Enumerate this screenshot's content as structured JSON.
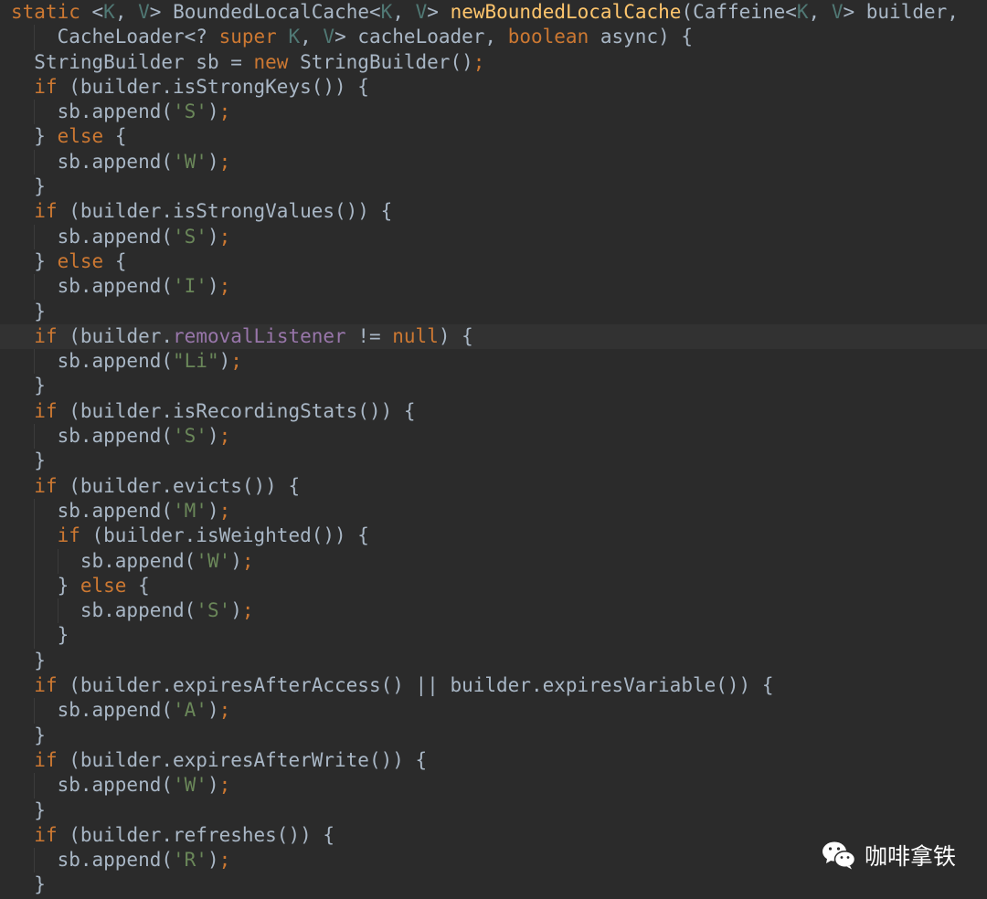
{
  "editor": {
    "lines": [
      {
        "indent": 0,
        "tokens": [
          {
            "t": "static ",
            "c": "kw"
          },
          {
            "t": "<",
            "c": "pl"
          },
          {
            "t": "K",
            "c": "tp"
          },
          {
            "t": ", ",
            "c": "pl"
          },
          {
            "t": "V",
            "c": "tp"
          },
          {
            "t": "> BoundedLocalCache<",
            "c": "pl"
          },
          {
            "t": "K",
            "c": "tp"
          },
          {
            "t": ", ",
            "c": "pl"
          },
          {
            "t": "V",
            "c": "tp"
          },
          {
            "t": "> ",
            "c": "pl"
          },
          {
            "t": "newBoundedLocalCache",
            "c": "fn"
          },
          {
            "t": "(Caffeine<",
            "c": "pl"
          },
          {
            "t": "K",
            "c": "tp"
          },
          {
            "t": ", ",
            "c": "pl"
          },
          {
            "t": "V",
            "c": "tp"
          },
          {
            "t": "> builder,",
            "c": "pl"
          }
        ]
      },
      {
        "indent": 2,
        "tokens": [
          {
            "t": "CacheLoader<? ",
            "c": "pl"
          },
          {
            "t": "super ",
            "c": "kw"
          },
          {
            "t": "K",
            "c": "tp"
          },
          {
            "t": ", ",
            "c": "pl"
          },
          {
            "t": "V",
            "c": "tp"
          },
          {
            "t": "> cacheLoader, ",
            "c": "pl"
          },
          {
            "t": "boolean ",
            "c": "kw"
          },
          {
            "t": "async) {",
            "c": "pl"
          }
        ]
      },
      {
        "indent": 1,
        "tokens": [
          {
            "t": "StringBuilder sb = ",
            "c": "pl"
          },
          {
            "t": "new ",
            "c": "kw"
          },
          {
            "t": "StringBuilder()",
            "c": "pl"
          },
          {
            "t": ";",
            "c": "kw"
          }
        ]
      },
      {
        "indent": 1,
        "tokens": [
          {
            "t": "if ",
            "c": "kw"
          },
          {
            "t": "(builder.isStrongKeys()) {",
            "c": "pl"
          }
        ]
      },
      {
        "indent": 2,
        "tokens": [
          {
            "t": "sb.append(",
            "c": "pl"
          },
          {
            "t": "'S'",
            "c": "str"
          },
          {
            "t": ")",
            "c": "pl"
          },
          {
            "t": ";",
            "c": "kw"
          }
        ]
      },
      {
        "indent": 1,
        "tokens": [
          {
            "t": "} ",
            "c": "pl"
          },
          {
            "t": "else ",
            "c": "kw"
          },
          {
            "t": "{",
            "c": "pl"
          }
        ]
      },
      {
        "indent": 2,
        "tokens": [
          {
            "t": "sb.append(",
            "c": "pl"
          },
          {
            "t": "'W'",
            "c": "str"
          },
          {
            "t": ")",
            "c": "pl"
          },
          {
            "t": ";",
            "c": "kw"
          }
        ]
      },
      {
        "indent": 1,
        "tokens": [
          {
            "t": "}",
            "c": "pl"
          }
        ]
      },
      {
        "indent": 1,
        "tokens": [
          {
            "t": "if ",
            "c": "kw"
          },
          {
            "t": "(builder.isStrongValues()) {",
            "c": "pl"
          }
        ]
      },
      {
        "indent": 2,
        "tokens": [
          {
            "t": "sb.append(",
            "c": "pl"
          },
          {
            "t": "'S'",
            "c": "str"
          },
          {
            "t": ")",
            "c": "pl"
          },
          {
            "t": ";",
            "c": "kw"
          }
        ]
      },
      {
        "indent": 1,
        "tokens": [
          {
            "t": "} ",
            "c": "pl"
          },
          {
            "t": "else ",
            "c": "kw"
          },
          {
            "t": "{",
            "c": "pl"
          }
        ]
      },
      {
        "indent": 2,
        "tokens": [
          {
            "t": "sb.append(",
            "c": "pl"
          },
          {
            "t": "'I'",
            "c": "str"
          },
          {
            "t": ")",
            "c": "pl"
          },
          {
            "t": ";",
            "c": "kw"
          }
        ]
      },
      {
        "indent": 1,
        "tokens": [
          {
            "t": "}",
            "c": "pl"
          }
        ]
      },
      {
        "indent": 1,
        "current": true,
        "tokens": [
          {
            "t": "if ",
            "c": "kw"
          },
          {
            "t": "(builder.",
            "c": "pl"
          },
          {
            "t": "removalListener",
            "c": "fld"
          },
          {
            "t": " != ",
            "c": "pl"
          },
          {
            "t": "null",
            "c": "kw"
          },
          {
            "t": ") {",
            "c": "pl"
          }
        ]
      },
      {
        "indent": 2,
        "tokens": [
          {
            "t": "sb.append(",
            "c": "pl"
          },
          {
            "t": "\"Li\"",
            "c": "str"
          },
          {
            "t": ")",
            "c": "pl"
          },
          {
            "t": ";",
            "c": "kw"
          }
        ]
      },
      {
        "indent": 1,
        "tokens": [
          {
            "t": "}",
            "c": "pl"
          }
        ]
      },
      {
        "indent": 1,
        "tokens": [
          {
            "t": "if ",
            "c": "kw"
          },
          {
            "t": "(builder.isRecordingStats()) {",
            "c": "pl"
          }
        ]
      },
      {
        "indent": 2,
        "tokens": [
          {
            "t": "sb.append(",
            "c": "pl"
          },
          {
            "t": "'S'",
            "c": "str"
          },
          {
            "t": ")",
            "c": "pl"
          },
          {
            "t": ";",
            "c": "kw"
          }
        ]
      },
      {
        "indent": 1,
        "tokens": [
          {
            "t": "}",
            "c": "pl"
          }
        ]
      },
      {
        "indent": 1,
        "tokens": [
          {
            "t": "if ",
            "c": "kw"
          },
          {
            "t": "(builder.evicts()) {",
            "c": "pl"
          }
        ]
      },
      {
        "indent": 2,
        "tokens": [
          {
            "t": "sb.append(",
            "c": "pl"
          },
          {
            "t": "'M'",
            "c": "str"
          },
          {
            "t": ")",
            "c": "pl"
          },
          {
            "t": ";",
            "c": "kw"
          }
        ]
      },
      {
        "indent": 2,
        "tokens": [
          {
            "t": "if ",
            "c": "kw"
          },
          {
            "t": "(builder.isWeighted()) {",
            "c": "pl"
          }
        ]
      },
      {
        "indent": 3,
        "tokens": [
          {
            "t": "sb.append(",
            "c": "pl"
          },
          {
            "t": "'W'",
            "c": "str"
          },
          {
            "t": ")",
            "c": "pl"
          },
          {
            "t": ";",
            "c": "kw"
          }
        ]
      },
      {
        "indent": 2,
        "tokens": [
          {
            "t": "} ",
            "c": "pl"
          },
          {
            "t": "else ",
            "c": "kw"
          },
          {
            "t": "{",
            "c": "pl"
          }
        ]
      },
      {
        "indent": 3,
        "tokens": [
          {
            "t": "sb.append(",
            "c": "pl"
          },
          {
            "t": "'S'",
            "c": "str"
          },
          {
            "t": ")",
            "c": "pl"
          },
          {
            "t": ";",
            "c": "kw"
          }
        ]
      },
      {
        "indent": 2,
        "tokens": [
          {
            "t": "}",
            "c": "pl"
          }
        ]
      },
      {
        "indent": 1,
        "tokens": [
          {
            "t": "}",
            "c": "pl"
          }
        ]
      },
      {
        "indent": 1,
        "tokens": [
          {
            "t": "if ",
            "c": "kw"
          },
          {
            "t": "(builder.expiresAfterAccess() || builder.expiresVariable()) {",
            "c": "pl"
          }
        ]
      },
      {
        "indent": 2,
        "tokens": [
          {
            "t": "sb.append(",
            "c": "pl"
          },
          {
            "t": "'A'",
            "c": "str"
          },
          {
            "t": ")",
            "c": "pl"
          },
          {
            "t": ";",
            "c": "kw"
          }
        ]
      },
      {
        "indent": 1,
        "tokens": [
          {
            "t": "}",
            "c": "pl"
          }
        ]
      },
      {
        "indent": 1,
        "tokens": [
          {
            "t": "if ",
            "c": "kw"
          },
          {
            "t": "(builder.expiresAfterWrite()) {",
            "c": "pl"
          }
        ]
      },
      {
        "indent": 2,
        "tokens": [
          {
            "t": "sb.append(",
            "c": "pl"
          },
          {
            "t": "'W'",
            "c": "str"
          },
          {
            "t": ")",
            "c": "pl"
          },
          {
            "t": ";",
            "c": "kw"
          }
        ]
      },
      {
        "indent": 1,
        "tokens": [
          {
            "t": "}",
            "c": "pl"
          }
        ]
      },
      {
        "indent": 1,
        "tokens": [
          {
            "t": "if ",
            "c": "kw"
          },
          {
            "t": "(builder.refreshes()) {",
            "c": "pl"
          }
        ]
      },
      {
        "indent": 2,
        "tokens": [
          {
            "t": "sb.append(",
            "c": "pl"
          },
          {
            "t": "'R'",
            "c": "str"
          },
          {
            "t": ")",
            "c": "pl"
          },
          {
            "t": ";",
            "c": "kw"
          }
        ]
      },
      {
        "indent": 1,
        "tokens": [
          {
            "t": "}",
            "c": "pl"
          }
        ]
      }
    ]
  },
  "watermark": {
    "icon": "wechat-icon",
    "text": "咖啡拿铁"
  },
  "colors": {
    "background": "#2b2b2b",
    "keyword": "#cc7832",
    "function": "#ffc66d",
    "type_param": "#507874",
    "field": "#9876aa",
    "string": "#6a8759",
    "plain": "#a9b7c6"
  }
}
